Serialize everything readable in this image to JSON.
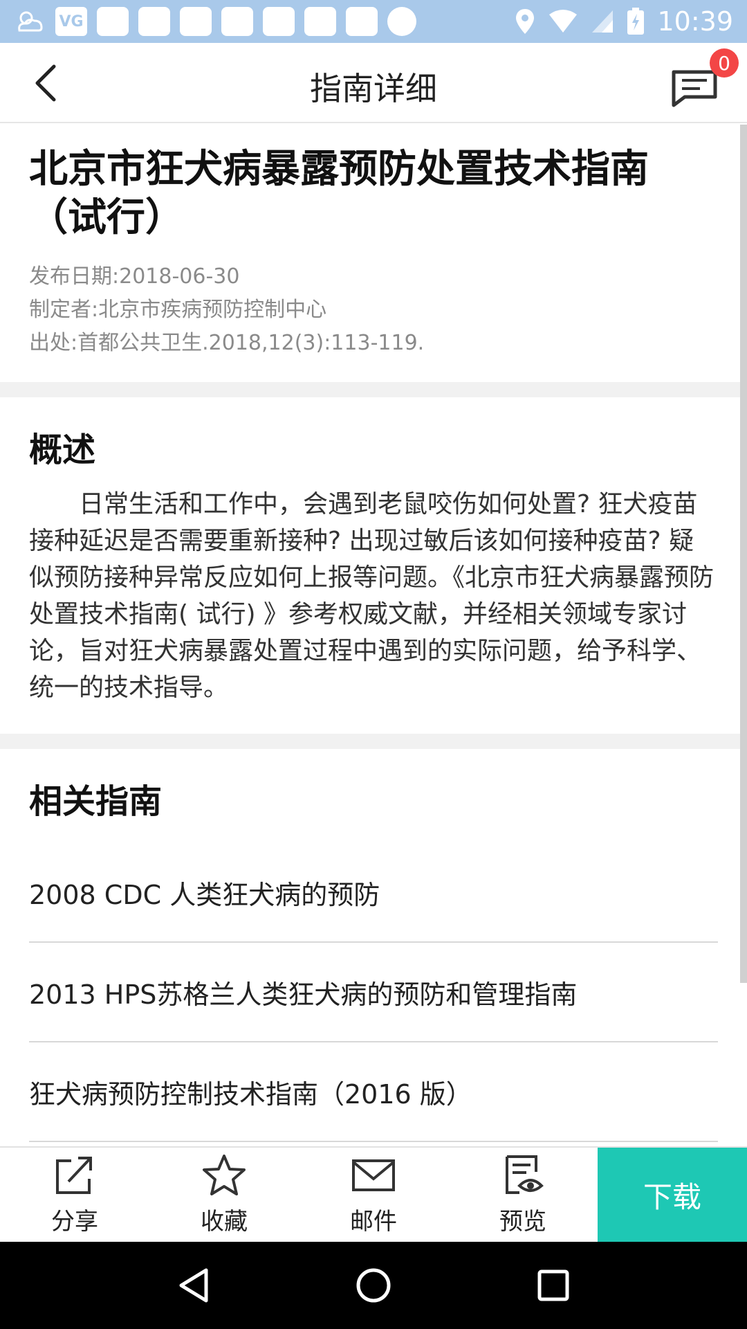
{
  "status_bar": {
    "time": "10:39",
    "left_badge": "VG"
  },
  "app_bar": {
    "title": "指南详细",
    "message_count": "0"
  },
  "guide": {
    "title": "北京市狂犬病暴露预防处置技术指南（试行）",
    "publish_date": "发布日期:2018-06-30",
    "author": "制定者:北京市疾病预防控制中心",
    "source": "出处:首都公共卫生.2018,12(3):113-119."
  },
  "summary": {
    "heading": "概述",
    "text": "日常生活和工作中，会遇到老鼠咬伤如何处置? 狂犬疫苗接种延迟是否需要重新接种? 出现过敏后该如何接种疫苗? 疑似预防接种异常反应如何上报等问题。《北京市狂犬病暴露预防处置技术指南( 试行) 》参考权威文献，并经相关领域专家讨论，旨对狂犬病暴露处置过程中遇到的实际问题，给予科学、统一的技术指导。"
  },
  "related": {
    "heading": "相关指南",
    "items": [
      "2008 CDC 人类狂犬病的预防",
      "2013 HPS苏格兰人类狂犬病的预防和管理指南",
      "狂犬病预防控制技术指南（2016 版）"
    ]
  },
  "bottom_bar": {
    "share": "分享",
    "favorite": "收藏",
    "mail": "邮件",
    "preview": "预览",
    "download": "下载"
  },
  "colors": {
    "status_bar": "#a9c9ea",
    "accent": "#1ec8b4",
    "badge": "#f34646"
  }
}
